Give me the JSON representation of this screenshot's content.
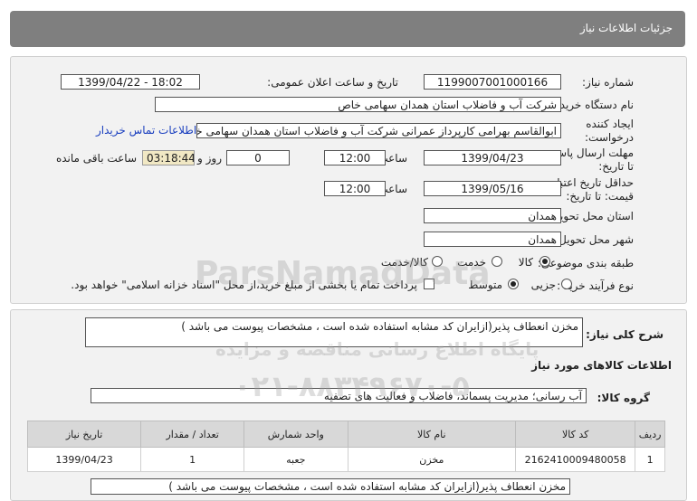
{
  "header": {
    "title": "جزئیات اطلاعات نیاز"
  },
  "fields": {
    "need_number_label": "شماره نیاز:",
    "need_number": "1199007001000166",
    "announce_label": "تاریخ و ساعت اعلان عمومی:",
    "announce_value": "1399/04/22 - 18:02",
    "buyer_label": "نام دستگاه خریدار:",
    "buyer_value": "شرکت آب و فاضلاب استان همدان سهامی خاص",
    "creator_label": "ایجاد کننده درخواست:",
    "creator_value": "ابوالقاسم بهرامی کارپرداز عمرانی شرکت آب و فاضلاب استان همدان سهامی خاص",
    "contact_link": "اطلاعات تماس خریدار",
    "deadline_label": "مهلت ارسال پاسخ: تا تاریخ:",
    "deadline_date": "1399/04/23",
    "time_label": "ساعت",
    "deadline_time": "12:00",
    "days_value": "0",
    "days_label": "روز و",
    "remaining_value": "03:18:44",
    "remaining_label": "ساعت باقی مانده",
    "validity_label": "حداقل تاریخ اعتبار قیمت: تا تاریخ:",
    "validity_date": "1399/05/16",
    "validity_time": "12:00",
    "province_label": "استان محل تحویل:",
    "province_value": "همدان",
    "city_label": "شهر محل تحویل:",
    "city_value": "همدان",
    "category_label": "طبقه بندی موضوعی:",
    "category_options": [
      "کالا",
      "خدمت",
      "کالا/خدمت"
    ],
    "purchase_label": "نوع فرآیند خرید :",
    "purchase_options": [
      "جزیی",
      "متوسط"
    ],
    "payment_note": "پرداخت تمام یا بخشی از مبلغ خرید،از محل \"اسناد خزانه اسلامی\" خواهد بود."
  },
  "summary": {
    "label": "شرح کلی نیاز:",
    "value": "مخزن انعطاف پذیر(ازایران کد مشابه استفاده شده است ، مشخصات پیوست می باشد )"
  },
  "goods": {
    "section_title": "اطلاعات کالاهای مورد نیاز",
    "group_label": "گروه کالا:",
    "group_value": "آب رسانی؛ مدیریت پسماند، فاضلاب و فعالیت های تصفیه",
    "columns": [
      "ردیف",
      "کد کالا",
      "نام کالا",
      "واحد شمارش",
      "تعداد / مقدار",
      "تاریخ نیاز"
    ],
    "rows": [
      [
        "1",
        "2162410009480058",
        "مخزن",
        "جعبه",
        "1",
        "1399/04/23"
      ]
    ],
    "item_desc": "مخزن انعطاف پذیر(ازایران کد مشابه استفاده شده است ، مشخصات پیوست می باشد )"
  },
  "watermark": {
    "brand": "ParsNamadData",
    "line1": "پایگاه اطلاع رسانی مناقصه و مزایده",
    "phone": "۰۲۱-۸۸۳۴۹۶۷۰-۵"
  }
}
